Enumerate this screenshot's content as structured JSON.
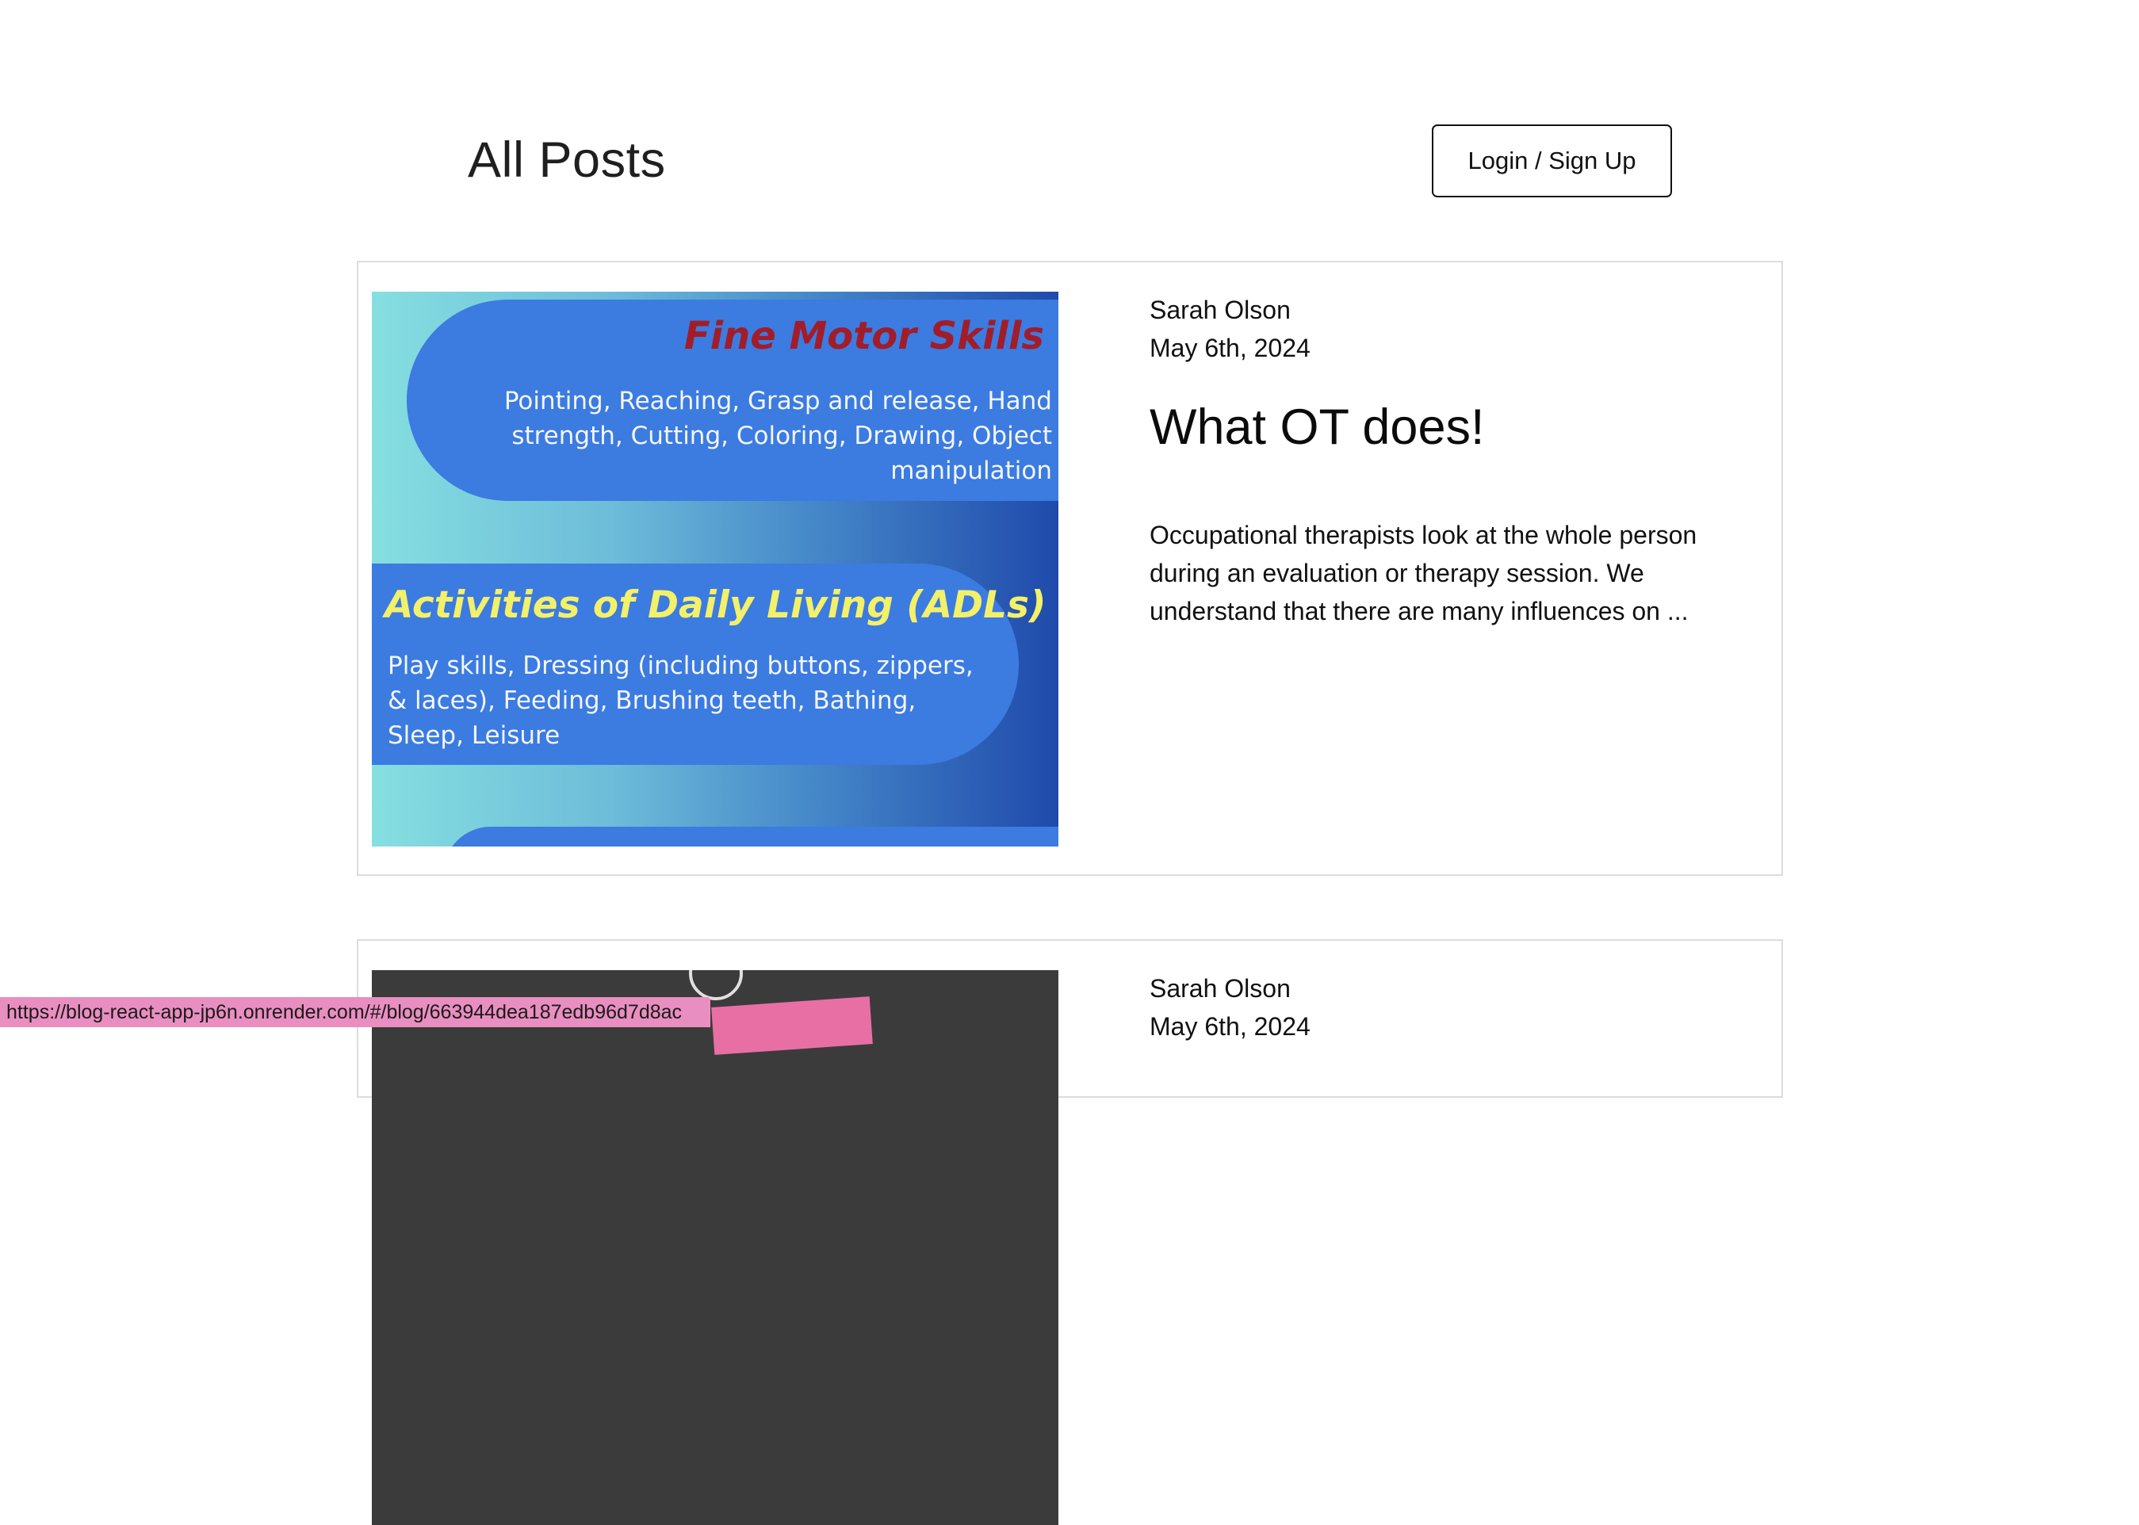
{
  "header": {
    "title": "All Posts",
    "login_label": "Login / Sign Up"
  },
  "posts": [
    {
      "author": "Sarah Olson",
      "date": "May 6th, 2024",
      "title": "What OT does!",
      "excerpt": "Occupational therapists look at the whole person during an evaluation or therapy session. We understand that there are many influences on ...",
      "image_text": {
        "fine_motor_title": "Fine Motor Skills",
        "fine_motor_body": "Pointing, Reaching, Grasp and release, Hand strength, Cutting, Coloring, Drawing, Object manipulation",
        "adl_title": "Activities of Daily Living (ADLs)",
        "adl_body": "Play skills, Dressing (including buttons, zippers, & laces), Feeding, Brushing teeth, Bathing, Sleep, Leisure"
      }
    },
    {
      "author": "Sarah Olson",
      "date": "May 6th, 2024"
    }
  ],
  "status_bar": {
    "url": "https://blog-react-app-jp6n.onrender.com/#/blog/663944dea187edb96d7d8ac"
  },
  "colors": {
    "card_border": "#dcdcdc",
    "image_pill_blue": "#3c7be0",
    "image_title_red": "#a11d2a",
    "image_title_yellow": "#f3f06a",
    "status_bar_pink": "#e98ec0"
  }
}
